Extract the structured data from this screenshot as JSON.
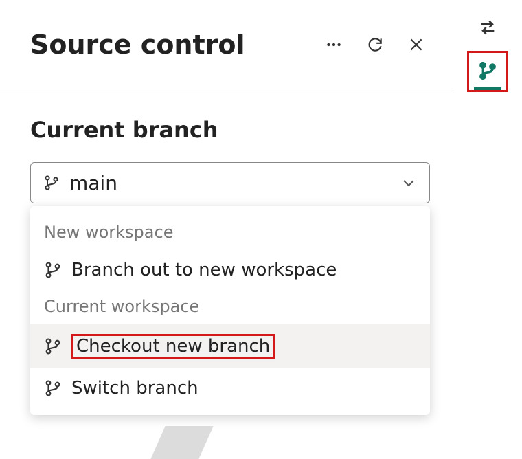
{
  "header": {
    "title": "Source control"
  },
  "section": {
    "label": "Current branch",
    "selected_branch": "main"
  },
  "dropdown": {
    "groups": [
      {
        "label": "New workspace",
        "items": [
          {
            "id": "branch-out",
            "label": "Branch out to new workspace"
          }
        ]
      },
      {
        "label": "Current workspace",
        "items": [
          {
            "id": "checkout-new",
            "label": "Checkout new branch",
            "highlighted": true
          },
          {
            "id": "switch",
            "label": "Switch branch"
          }
        ]
      }
    ]
  }
}
